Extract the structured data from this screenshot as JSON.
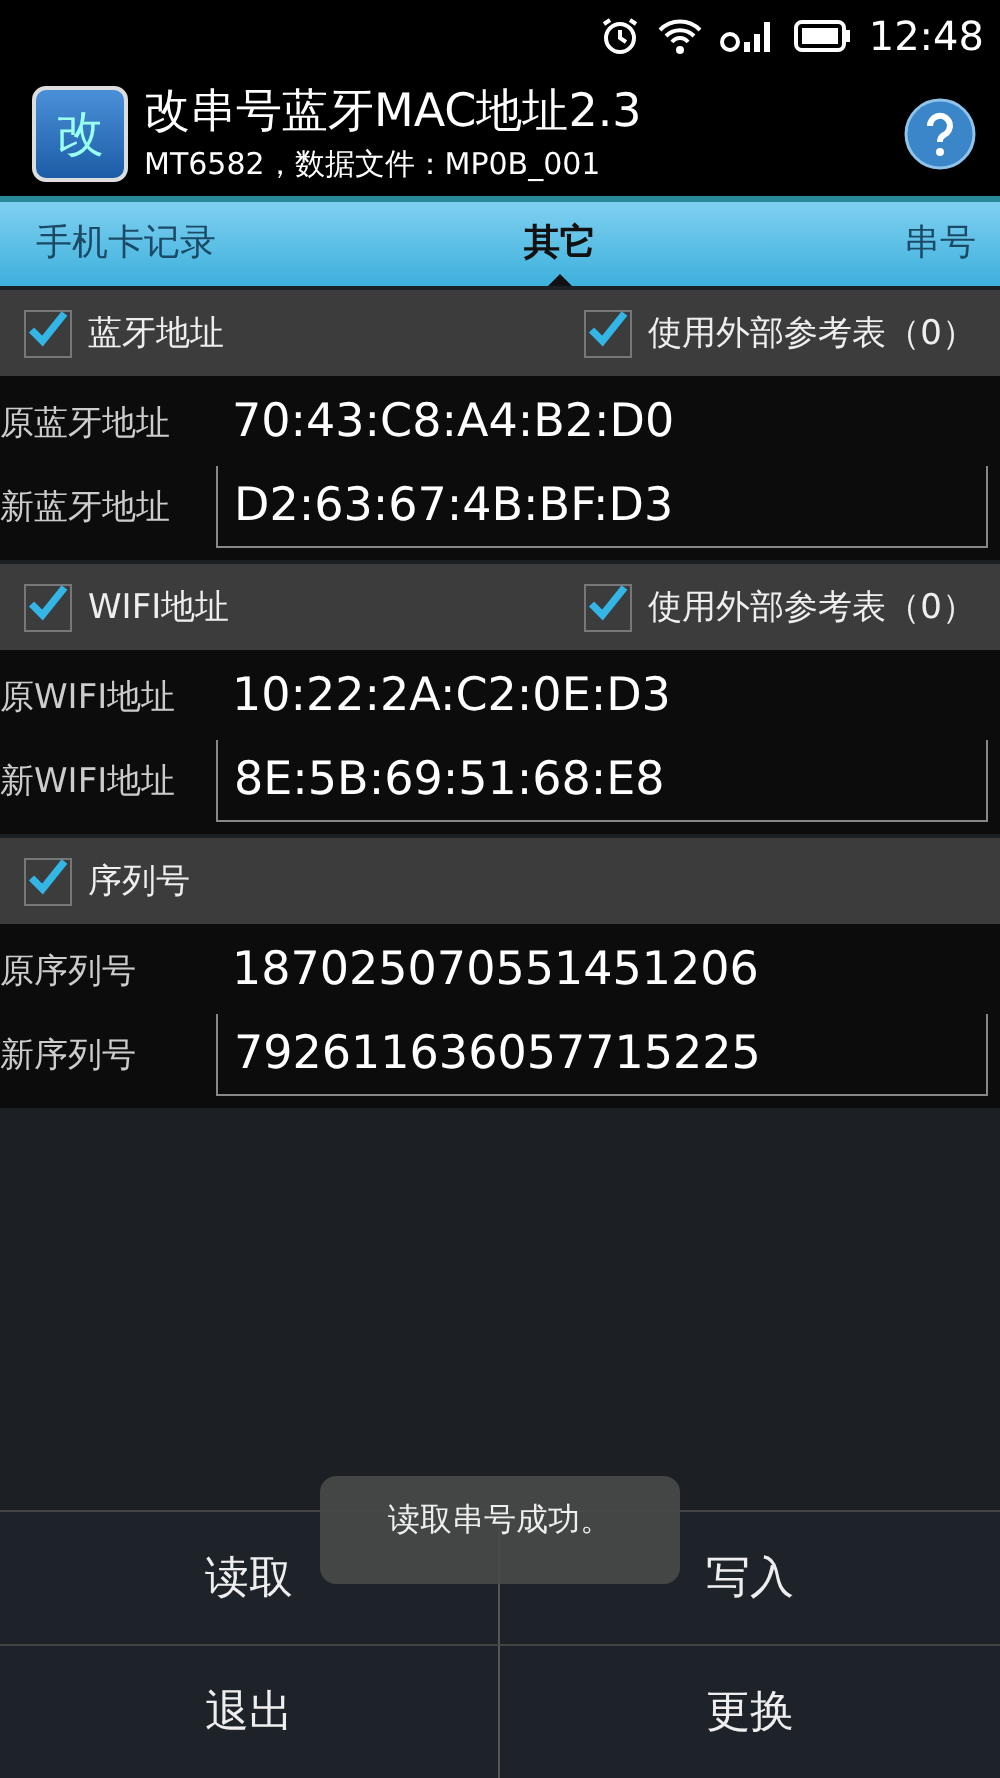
{
  "status_bar": {
    "time": "12:48"
  },
  "title_bar": {
    "app_icon_text": "改",
    "title": "改串号蓝牙MAC地址2.3",
    "subtitle": "MT6582，数据文件：MP0B_001"
  },
  "tabs": [
    {
      "label": "手机卡记录",
      "selected": false
    },
    {
      "label": "其它",
      "selected": true
    },
    {
      "label": "串号",
      "selected": false
    }
  ],
  "sections": [
    {
      "label": "蓝牙地址",
      "checked": true,
      "reference": {
        "label": "使用外部参考表（0）",
        "checked": true
      },
      "fields": [
        {
          "kind": "readonly",
          "label": "原蓝牙地址",
          "value": "70:43:C8:A4:B2:D0"
        },
        {
          "kind": "input",
          "label": "新蓝牙地址",
          "value": "D2:63:67:4B:BF:D3"
        }
      ]
    },
    {
      "label": "WIFI地址",
      "checked": true,
      "reference": {
        "label": "使用外部参考表（0）",
        "checked": true
      },
      "fields": [
        {
          "kind": "readonly",
          "label": "原WIFI地址",
          "value": "10:22:2A:C2:0E:D3"
        },
        {
          "kind": "input",
          "label": "新WIFI地址",
          "value": "8E:5B:69:51:68:E8"
        }
      ]
    },
    {
      "label": "序列号",
      "checked": true,
      "fields": [
        {
          "kind": "readonly",
          "label": "原序列号",
          "value": "187025070551451206"
        },
        {
          "kind": "input",
          "label": "新序列号",
          "value": "792611636057715225"
        }
      ]
    }
  ],
  "toast": "读取串号成功。",
  "buttons": [
    "读取",
    "写入",
    "退出",
    "更换"
  ]
}
